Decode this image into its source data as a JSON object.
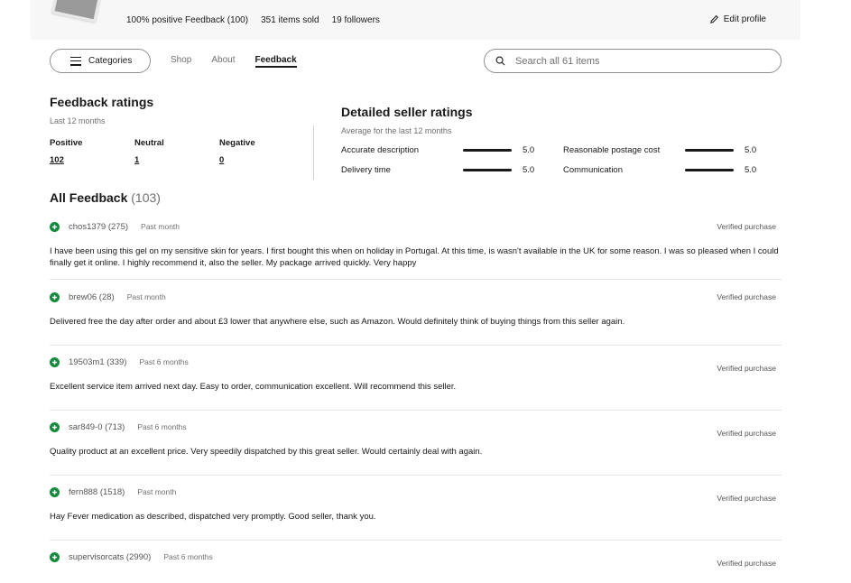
{
  "seller": {
    "positive_feedback": "100% positive Feedback (100)",
    "items_sold": "351 items sold",
    "followers": "19 followers",
    "edit_label": "Edit profile"
  },
  "nav": {
    "categories_label": "Categories",
    "tabs": [
      "Shop",
      "About",
      "Feedback"
    ],
    "active_tab": "Feedback",
    "search_placeholder": "Search all 61 items"
  },
  "feedback_ratings": {
    "title": "Feedback ratings",
    "subtitle": "Last 12 months",
    "positive_label": "Positive",
    "positive_value": "102",
    "neutral_label": "Neutral",
    "neutral_value": "1",
    "negative_label": "Negative",
    "negative_value": "0"
  },
  "detailed_ratings": {
    "title": "Detailed seller ratings",
    "subtitle": "Average for the last 12 months",
    "items": [
      {
        "name": "Accurate description",
        "value": "5.0",
        "fraction": 1.0
      },
      {
        "name": "Reasonable postage cost",
        "value": "5.0",
        "fraction": 1.0
      },
      {
        "name": "Delivery time",
        "value": "5.0",
        "fraction": 1.0
      },
      {
        "name": "Communication",
        "value": "5.0",
        "fraction": 1.0
      }
    ]
  },
  "all_feedback": {
    "title": "All Feedback",
    "count": "(103)",
    "items": [
      {
        "user": "chos1379 (275)",
        "time": "Past month",
        "verified": "Verified purchase",
        "text": "I have been using this gel on my sensitive skin for years. I first bought this when on holiday in Portugal. At this time, is wasn't available in the UK for some reason. I was so pleased when I could finally get it online. I highly recommend it, also the seller. My package arrived quickly. Very happy"
      },
      {
        "user": "brew06 (28)",
        "time": "Past month",
        "verified": "Verified purchase",
        "text": "Delivered free the day after order and about £3 lower that anywhere else, such as Amazon. Would definitely think of buying things from this seller again."
      },
      {
        "user": "19503m1 (339)",
        "time": "Past 6 months",
        "verified": "Verified purchase",
        "text": "Excellent service item arrived next day. Easy to order, communication excellent. Will recommend this seller."
      },
      {
        "user": "sar849-0 (713)",
        "time": "Past 6 months",
        "verified": "Verified purchase",
        "text": "Quality product at an excellent price. Very speedily dispatched by this great seller. Would certainly deal with again."
      },
      {
        "user": "fern888 (1518)",
        "time": "Past month",
        "verified": "Verified purchase",
        "text": "Hay Fever medication as described, dispatched very promptly. Good seller, thank you."
      },
      {
        "user": "supervisorcats (2990)",
        "time": "Past 6 months",
        "verified": "Verified purchase",
        "text": ""
      }
    ]
  },
  "colors": {
    "positive_green": "#118a3a",
    "header_bg": "#f7f7f7",
    "text_dark": "#191919",
    "text_muted": "#707070"
  }
}
